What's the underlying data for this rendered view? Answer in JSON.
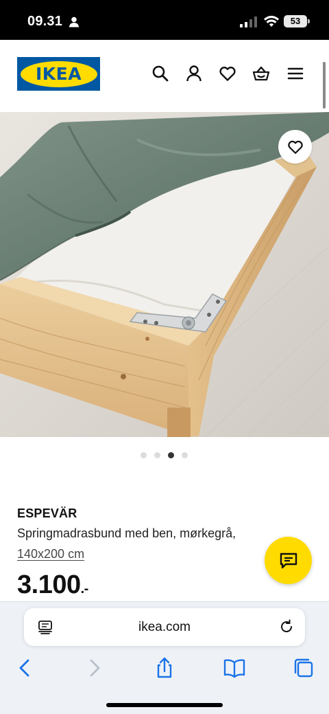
{
  "status_bar": {
    "time": "09.31",
    "battery": "53"
  },
  "header": {
    "logo_text": "IKEA"
  },
  "colors": {
    "brand_blue": "#0058a3",
    "brand_yellow": "#ffdb00",
    "safari_accent": "#1a73e8"
  },
  "icons": [
    "search-icon",
    "account-icon",
    "heart-icon",
    "basket-icon",
    "menu-icon",
    "chat-icon",
    "tabs-icon",
    "reload-icon",
    "back-icon",
    "forward-icon",
    "share-icon",
    "bookmarks-icon",
    "tab-overview-icon"
  ],
  "carousel": {
    "total": 4,
    "active_index": 2
  },
  "product": {
    "name": "ESPEVÄR",
    "description": "Springmadrasbund med ben, mørkegrå,",
    "size": "140x200 cm",
    "price": "3.100",
    "price_suffix": ".-"
  },
  "browser": {
    "url": "ikea.com"
  }
}
